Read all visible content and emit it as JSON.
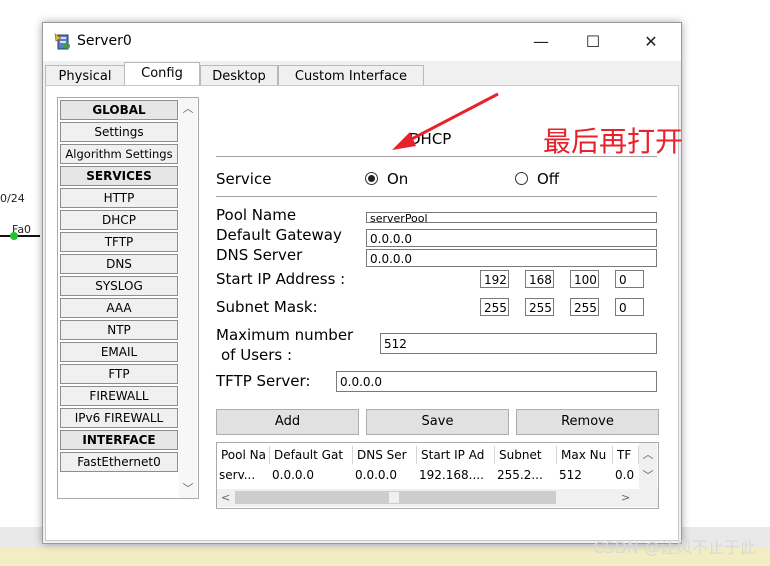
{
  "window": {
    "title": "Server0",
    "controls": {
      "minimize": "—",
      "maximize": "☐",
      "close": "✕"
    }
  },
  "tabs": [
    {
      "label": "Physical"
    },
    {
      "label": "Config",
      "active": true
    },
    {
      "label": "Desktop"
    },
    {
      "label": "Custom Interface"
    }
  ],
  "sidebar": {
    "items": [
      {
        "label": "GLOBAL",
        "header": true
      },
      {
        "label": "Settings"
      },
      {
        "label": "Algorithm Settings"
      },
      {
        "label": "SERVICES",
        "header": true
      },
      {
        "label": "HTTP"
      },
      {
        "label": "DHCP"
      },
      {
        "label": "TFTP"
      },
      {
        "label": "DNS"
      },
      {
        "label": "SYSLOG"
      },
      {
        "label": "AAA"
      },
      {
        "label": "NTP"
      },
      {
        "label": "EMAIL"
      },
      {
        "label": "FTP"
      },
      {
        "label": "FIREWALL"
      },
      {
        "label": "IPv6 FIREWALL"
      },
      {
        "label": "INTERFACE",
        "header": true
      },
      {
        "label": "FastEthernet0"
      }
    ]
  },
  "dhcp": {
    "section_title": "DHCP",
    "service_label": "Service",
    "on_label": "On",
    "off_label": "Off",
    "service_on": true,
    "pool_name_label": "Pool Name",
    "pool_name_value": "serverPool",
    "default_gateway_label": "Default Gateway",
    "default_gateway_value": "0.0.0.0",
    "dns_server_label": "DNS Server",
    "dns_server_value": "0.0.0.0",
    "start_ip_label": "Start IP Address :",
    "start_ip": [
      "192",
      "168",
      "100",
      "0"
    ],
    "subnet_mask_label": "Subnet Mask:",
    "subnet_mask": [
      "255",
      "255",
      "255",
      "0"
    ],
    "max_users_label_1": "Maximum number",
    "max_users_label_2": "of Users :",
    "max_users_value": "512",
    "tftp_server_label": "TFTP Server:",
    "tftp_server_value": "0.0.0.0",
    "buttons": {
      "add": "Add",
      "save": "Save",
      "remove": "Remove"
    },
    "table": {
      "headers": [
        "Pool Na",
        "Default Gat",
        "DNS Ser",
        "Start IP Ad",
        "Subnet",
        "Max Nu",
        "TF"
      ],
      "rows": [
        [
          "serv...",
          "0.0.0.0",
          "0.0.0.0",
          "192.168....",
          "255.2...",
          "512",
          "0.0"
        ]
      ]
    }
  },
  "background": {
    "label_left": "0/24",
    "label_fa0": "Fa0"
  },
  "annotation": {
    "text": "最后再打开",
    "color": "#e8222a"
  },
  "watermark": "CSDN @让风不止于此"
}
